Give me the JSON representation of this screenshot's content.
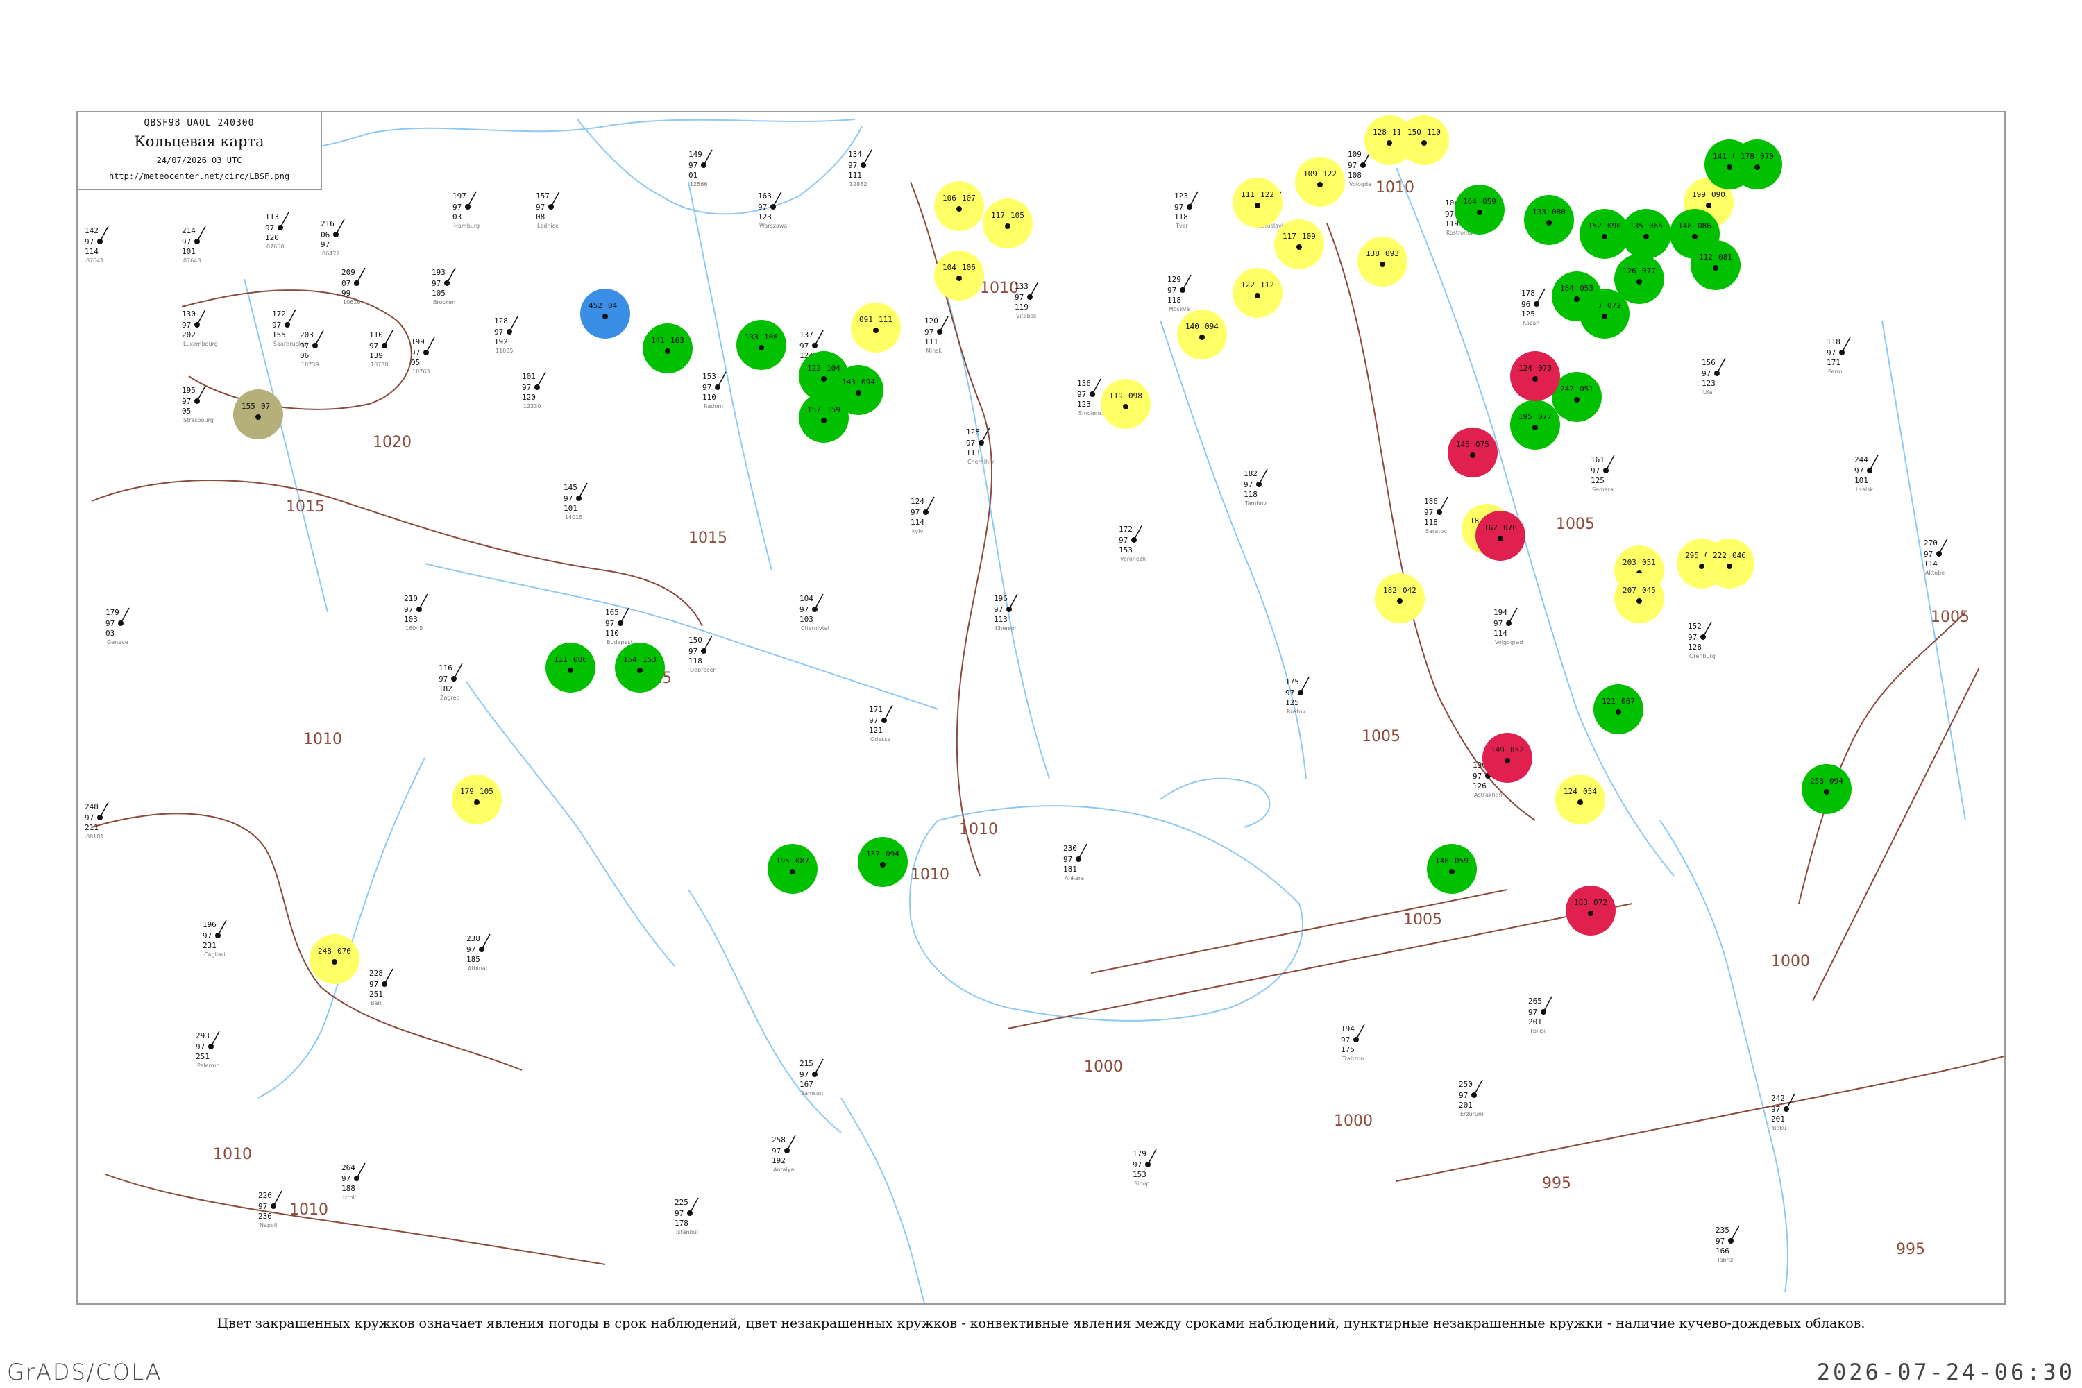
{
  "header": {
    "code": "QBSF98  UAOL  240300",
    "title": "Кольцевая карта",
    "date": "24/07/2026 03 UTC",
    "url": "http://meteocenter.net/circ/LBSF.png"
  },
  "caption": "Цвет закрашенных кружков означает явления погоды в срок наблюдений, цвет незакрашенных кружков - конвективные явления между сроками наблюдений, пунктирные незакрашенные кружки - наличие кучево-дождевых облаков.",
  "footer": {
    "left": "GrADS/COLA",
    "right": "2026-07-24-06:30"
  },
  "colors": {
    "precip_green": "#00c000",
    "fog_yellow": "#ffff66",
    "thunder_red": "#e0204f",
    "snow_blue": "#3a8ee6",
    "haze_olive": "#b5b07a",
    "isobar": "#8b4a3a",
    "river": "#8ec9f5",
    "border": "#9a9a9a"
  },
  "isobars": [
    {
      "label": "1020"
    },
    {
      "label": "1015"
    },
    {
      "label": "1015"
    },
    {
      "label": "1010"
    },
    {
      "label": "1010"
    },
    {
      "label": "1010"
    },
    {
      "label": "1010"
    },
    {
      "label": "1010"
    },
    {
      "label": "1005"
    },
    {
      "label": "1005"
    },
    {
      "label": "1005"
    },
    {
      "label": "1005"
    },
    {
      "label": "1000"
    },
    {
      "label": "1000"
    },
    {
      "label": "1000"
    },
    {
      "label": "995"
    },
    {
      "label": "995"
    },
    {
      "label": "1010"
    },
    {
      "label": "1015"
    },
    {
      "label": "1010"
    }
  ],
  "stations": [
    {
      "p": "142",
      "t": "97",
      "d": "114",
      "name": "07641"
    },
    {
      "p": "214",
      "t": "97",
      "d": "101",
      "name": "07643"
    },
    {
      "p": "113",
      "t": "97",
      "d": "120",
      "name": "07650"
    },
    {
      "p": "216",
      "t": "06",
      "d": "97",
      "name": "06477"
    },
    {
      "p": "130",
      "t": "97",
      "d": "202",
      "name": "Luxembourg"
    },
    {
      "p": "172",
      "t": "97",
      "d": "155",
      "name": "Saarbrucken"
    },
    {
      "p": "209",
      "t": "07",
      "d": "99",
      "name": "10616"
    },
    {
      "p": "195",
      "t": "97",
      "d": "05",
      "name": "Strasbourg"
    },
    {
      "p": "203",
      "t": "97",
      "d": "06",
      "name": "10739"
    },
    {
      "p": "110",
      "t": "97",
      "d": "139",
      "name": "10738"
    },
    {
      "p": "199",
      "t": "97",
      "d": "05",
      "name": "10763"
    },
    {
      "p": "197",
      "t": "97",
      "d": "03",
      "name": "Hamburg"
    },
    {
      "p": "193",
      "t": "97",
      "d": "105",
      "name": "Brocken"
    },
    {
      "p": "128",
      "t": "97",
      "d": "192",
      "name": "11035"
    },
    {
      "p": "157",
      "t": "97",
      "d": "08",
      "name": "Lednice"
    },
    {
      "p": "179",
      "t": "97",
      "d": "03",
      "name": "Geneve"
    },
    {
      "p": "101",
      "t": "97",
      "d": "120",
      "name": "12330"
    },
    {
      "p": "149",
      "t": "97",
      "d": "01",
      "name": "12566"
    },
    {
      "p": "163",
      "t": "97",
      "d": "123",
      "name": "Warszawa"
    },
    {
      "p": "134",
      "t": "97",
      "d": "111",
      "name": "12882"
    },
    {
      "p": "153",
      "t": "97",
      "d": "110",
      "name": "Radom"
    },
    {
      "p": "137",
      "t": "97",
      "d": "124",
      "name": "Lublin"
    },
    {
      "p": "210",
      "t": "97",
      "d": "103",
      "name": "16045"
    },
    {
      "p": "145",
      "t": "97",
      "d": "101",
      "name": "14015"
    },
    {
      "p": "116",
      "t": "97",
      "d": "182",
      "name": "Zagreb"
    },
    {
      "p": "165",
      "t": "97",
      "d": "110",
      "name": "Budapest"
    },
    {
      "p": "150",
      "t": "97",
      "d": "118",
      "name": "Debrecen"
    },
    {
      "p": "104",
      "t": "97",
      "d": "103",
      "name": "Chernivtsi"
    },
    {
      "p": "171",
      "t": "97",
      "d": "121",
      "name": "Odessa"
    },
    {
      "p": "196",
      "t": "97",
      "d": "113",
      "name": "Kherson"
    },
    {
      "p": "124",
      "t": "97",
      "d": "114",
      "name": "Kyiv"
    },
    {
      "p": "128",
      "t": "97",
      "d": "113",
      "name": "Chernihiv"
    },
    {
      "p": "120",
      "t": "97",
      "d": "111",
      "name": "Minsk"
    },
    {
      "p": "133",
      "t": "97",
      "d": "119",
      "name": "Vitebsk"
    },
    {
      "p": "136",
      "t": "97",
      "d": "123",
      "name": "Smolensk"
    },
    {
      "p": "129",
      "t": "97",
      "d": "118",
      "name": "Moskva"
    },
    {
      "p": "123",
      "t": "97",
      "d": "118",
      "name": "Tver"
    },
    {
      "p": "111",
      "t": "96",
      "d": "111",
      "name": "Yaroslavl"
    },
    {
      "p": "109",
      "t": "97",
      "d": "108",
      "name": "Vologda"
    },
    {
      "p": "104",
      "t": "97",
      "d": "119",
      "name": "Kostroma"
    },
    {
      "p": "172",
      "t": "97",
      "d": "153",
      "name": "Voronezh"
    },
    {
      "p": "182",
      "t": "97",
      "d": "118",
      "name": "Tambov"
    },
    {
      "p": "186",
      "t": "97",
      "d": "118",
      "name": "Saratov"
    },
    {
      "p": "194",
      "t": "97",
      "d": "114",
      "name": "Volgograd"
    },
    {
      "p": "190",
      "t": "97",
      "d": "126",
      "name": "Astrakhan"
    },
    {
      "p": "175",
      "t": "97",
      "d": "125",
      "name": "Rostov"
    },
    {
      "p": "178",
      "t": "96",
      "d": "125",
      "name": "Kazan"
    },
    {
      "p": "161",
      "t": "97",
      "d": "125",
      "name": "Samara"
    },
    {
      "p": "152",
      "t": "97",
      "d": "128",
      "name": "Orenburg"
    },
    {
      "p": "156",
      "t": "97",
      "d": "123",
      "name": "Ufa"
    },
    {
      "p": "118",
      "t": "97",
      "d": "171",
      "name": "Perm"
    },
    {
      "p": "244",
      "t": "97",
      "d": "101",
      "name": "Uralsk"
    },
    {
      "p": "270",
      "t": "97",
      "d": "114",
      "name": "Aktobe"
    },
    {
      "p": "248",
      "t": "97",
      "d": "211",
      "name": "08181"
    },
    {
      "p": "196",
      "t": "97",
      "d": "231",
      "name": "Cagliari"
    },
    {
      "p": "293",
      "t": "97",
      "d": "251",
      "name": "Palermo"
    },
    {
      "p": "226",
      "t": "97",
      "d": "236",
      "name": "Napoli"
    },
    {
      "p": "228",
      "t": "97",
      "d": "251",
      "name": "Bari"
    },
    {
      "p": "238",
      "t": "97",
      "d": "185",
      "name": "Athinai"
    },
    {
      "p": "264",
      "t": "97",
      "d": "188",
      "name": "Izmir"
    },
    {
      "p": "258",
      "t": "97",
      "d": "192",
      "name": "Antalya"
    },
    {
      "p": "225",
      "t": "97",
      "d": "178",
      "name": "Istanbul"
    },
    {
      "p": "215",
      "t": "97",
      "d": "167",
      "name": "Samsun"
    },
    {
      "p": "179",
      "t": "97",
      "d": "153",
      "name": "Sinop"
    },
    {
      "p": "230",
      "t": "97",
      "d": "181",
      "name": "Ankara"
    },
    {
      "p": "194",
      "t": "97",
      "d": "175",
      "name": "Trabzon"
    },
    {
      "p": "250",
      "t": "97",
      "d": "201",
      "name": "Erzurum"
    },
    {
      "p": "265",
      "t": "97",
      "d": "201",
      "name": "Tbilisi"
    },
    {
      "p": "242",
      "t": "97",
      "d": "201",
      "name": "Baku"
    },
    {
      "p": "235",
      "t": "97",
      "d": "166",
      "name": "Tabriz"
    }
  ],
  "markers": [
    {
      "p": "452",
      "t": "04",
      "kind": "snow"
    },
    {
      "p": "155",
      "t": "07",
      "kind": "haze"
    },
    {
      "p": "179",
      "t": "105",
      "kind": "fog"
    },
    {
      "p": "248",
      "t": "076",
      "kind": "fog"
    },
    {
      "p": "091",
      "t": "111",
      "kind": "fog"
    },
    {
      "p": "106",
      "t": "107",
      "kind": "fog"
    },
    {
      "p": "104",
      "t": "106",
      "kind": "fog"
    },
    {
      "p": "117",
      "t": "105",
      "kind": "fog"
    },
    {
      "p": "119",
      "t": "098",
      "kind": "fog"
    },
    {
      "p": "140",
      "t": "094",
      "kind": "fog"
    },
    {
      "p": "111",
      "t": "122",
      "kind": "fog"
    },
    {
      "p": "117",
      "t": "109",
      "kind": "fog"
    },
    {
      "p": "122",
      "t": "112",
      "kind": "fog"
    },
    {
      "p": "109",
      "t": "122",
      "kind": "fog"
    },
    {
      "p": "128",
      "t": "111",
      "kind": "fog"
    },
    {
      "p": "150",
      "t": "110",
      "kind": "fog"
    },
    {
      "p": "138",
      "t": "093",
      "kind": "fog"
    },
    {
      "p": "199",
      "t": "090",
      "kind": "fog"
    },
    {
      "p": "182",
      "t": "049",
      "kind": "fog"
    },
    {
      "p": "203",
      "t": "051",
      "kind": "fog"
    },
    {
      "p": "207",
      "t": "045",
      "kind": "fog"
    },
    {
      "p": "182",
      "t": "042",
      "kind": "fog"
    },
    {
      "p": "124",
      "t": "054",
      "kind": "fog"
    },
    {
      "p": "295",
      "t": "054",
      "kind": "fog"
    },
    {
      "p": "222",
      "t": "046",
      "kind": "fog"
    },
    {
      "p": "141",
      "t": "163",
      "kind": "rain"
    },
    {
      "p": "133",
      "t": "106",
      "kind": "rain"
    },
    {
      "p": "122",
      "t": "104",
      "kind": "rain"
    },
    {
      "p": "143",
      "t": "094",
      "kind": "rain"
    },
    {
      "p": "157",
      "t": "159",
      "kind": "rain"
    },
    {
      "p": "154",
      "t": "153",
      "kind": "rain"
    },
    {
      "p": "111",
      "t": "086",
      "kind": "rain"
    },
    {
      "p": "137",
      "t": "094",
      "kind": "rain"
    },
    {
      "p": "195",
      "t": "087",
      "kind": "rain"
    },
    {
      "p": "148",
      "t": "059",
      "kind": "rain"
    },
    {
      "p": "164",
      "t": "059",
      "kind": "rain"
    },
    {
      "p": "133",
      "t": "080",
      "kind": "rain"
    },
    {
      "p": "152",
      "t": "090",
      "kind": "rain"
    },
    {
      "p": "135",
      "t": "065",
      "kind": "rain"
    },
    {
      "p": "148",
      "t": "086",
      "kind": "rain"
    },
    {
      "p": "112",
      "t": "081",
      "kind": "rain"
    },
    {
      "p": "126",
      "t": "077",
      "kind": "rain"
    },
    {
      "p": "163",
      "t": "072",
      "kind": "rain"
    },
    {
      "p": "141",
      "t": "068",
      "kind": "rain"
    },
    {
      "p": "178",
      "t": "070",
      "kind": "rain"
    },
    {
      "p": "184",
      "t": "053",
      "kind": "rain"
    },
    {
      "p": "247",
      "t": "051",
      "kind": "rain"
    },
    {
      "p": "195",
      "t": "077",
      "kind": "rain"
    },
    {
      "p": "121",
      "t": "067",
      "kind": "rain"
    },
    {
      "p": "258",
      "t": "094",
      "kind": "rain"
    },
    {
      "p": "124",
      "t": "070",
      "kind": "thunder"
    },
    {
      "p": "145",
      "t": "075",
      "kind": "thunder"
    },
    {
      "p": "162",
      "t": "076",
      "kind": "thunder"
    },
    {
      "p": "183",
      "t": "072",
      "kind": "thunder"
    },
    {
      "p": "149",
      "t": "052",
      "kind": "thunder"
    }
  ]
}
